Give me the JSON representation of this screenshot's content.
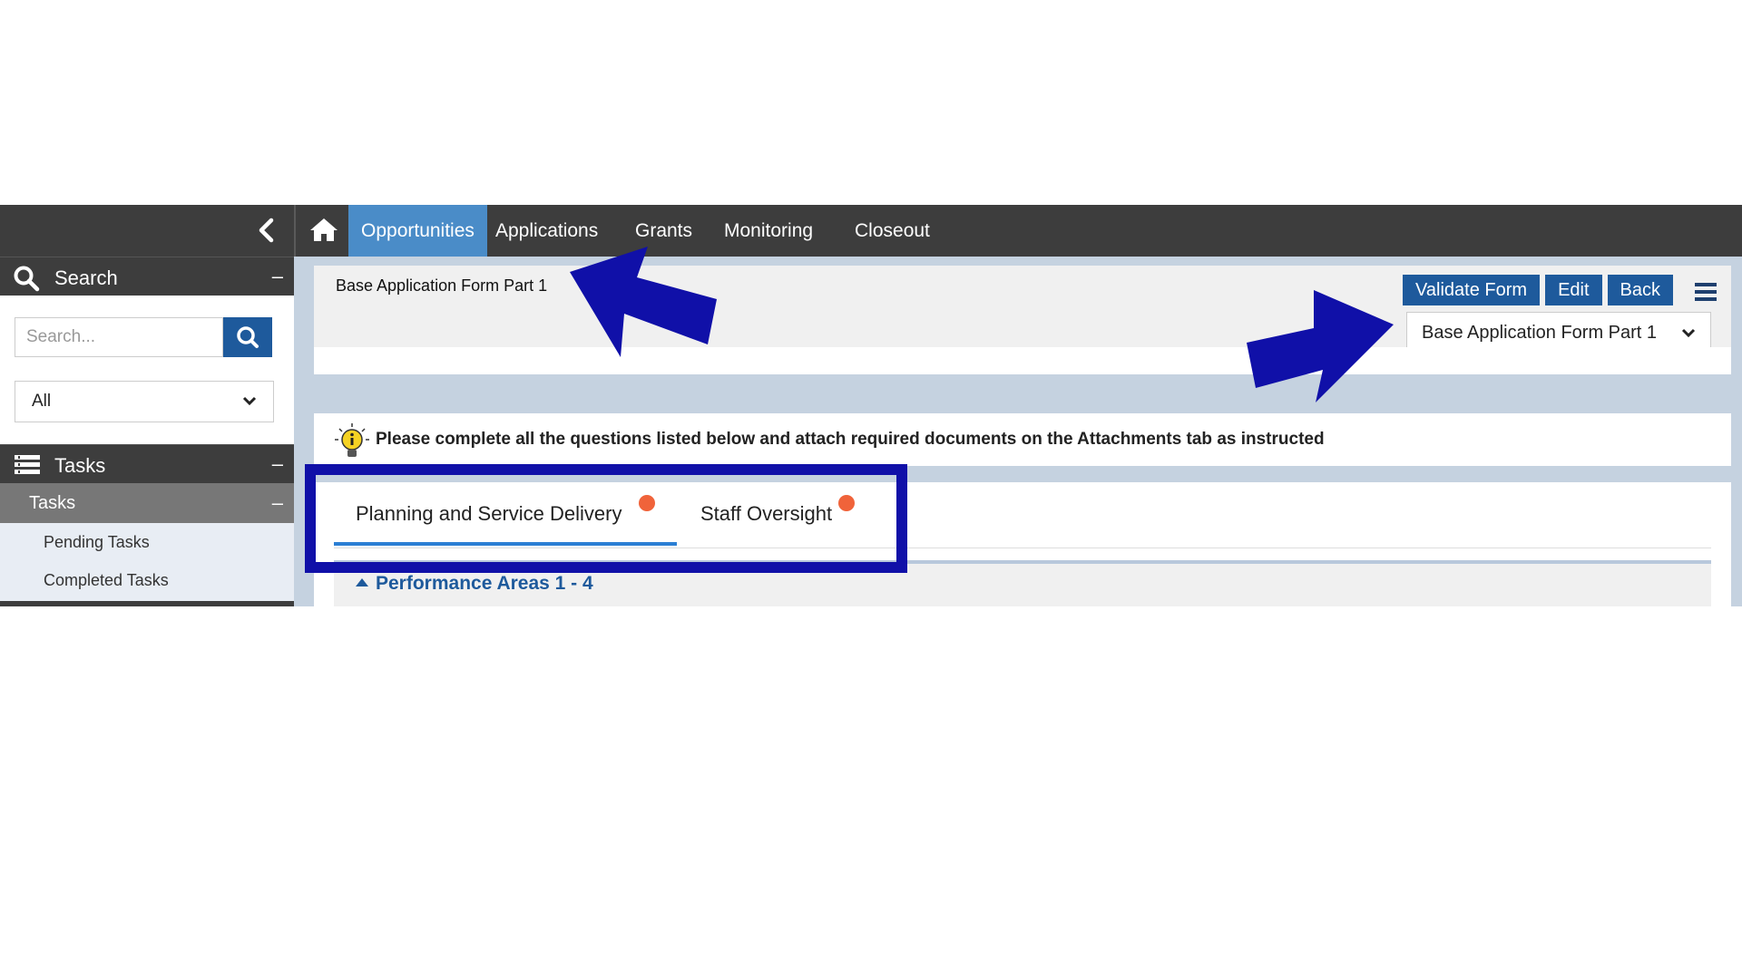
{
  "sidebar": {
    "search_section": {
      "title": "Search",
      "collapse_symbol": "–"
    },
    "search_placeholder": "Search...",
    "scope_value": "All",
    "tasks_section": {
      "title": "Tasks",
      "collapse_symbol": "–"
    },
    "tasks_group": {
      "title": "Tasks",
      "collapse_symbol": "–"
    },
    "task_items": [
      "Pending Tasks",
      "Completed Tasks"
    ]
  },
  "nav": {
    "items": [
      "Opportunities",
      "Applications",
      "Grants",
      "Monitoring",
      "Closeout"
    ],
    "active": "Opportunities"
  },
  "form": {
    "title": "Base Application Form Part 1",
    "buttons": {
      "validate": "Validate Form",
      "edit": "Edit",
      "back": "Back"
    },
    "selected_form": "Base Application Form Part 1"
  },
  "info_message": "Please complete all the questions listed below and attach required documents on the Attachments tab as instructed",
  "tabs": [
    {
      "label": "Planning and Service Delivery",
      "active": true,
      "has_error_dot": true
    },
    {
      "label": "Staff Oversight",
      "active": false,
      "has_error_dot": true
    }
  ],
  "section": {
    "title": "Performance Areas 1 - 4"
  },
  "icons": {
    "collapse": "chevron-left-icon",
    "home": "home-icon",
    "search": "search-icon",
    "tasks": "list-icon",
    "menu": "hamburger-icon",
    "info": "lightbulb-icon",
    "select": "chevron-down-icon"
  },
  "colors": {
    "nav_bg": "#3d3d3d",
    "nav_active": "#4a8cc8",
    "button": "#1e5a9c",
    "tab_underline": "#2b7fd4",
    "error_dot": "#f0633a",
    "annotation": "#1010a8"
  }
}
